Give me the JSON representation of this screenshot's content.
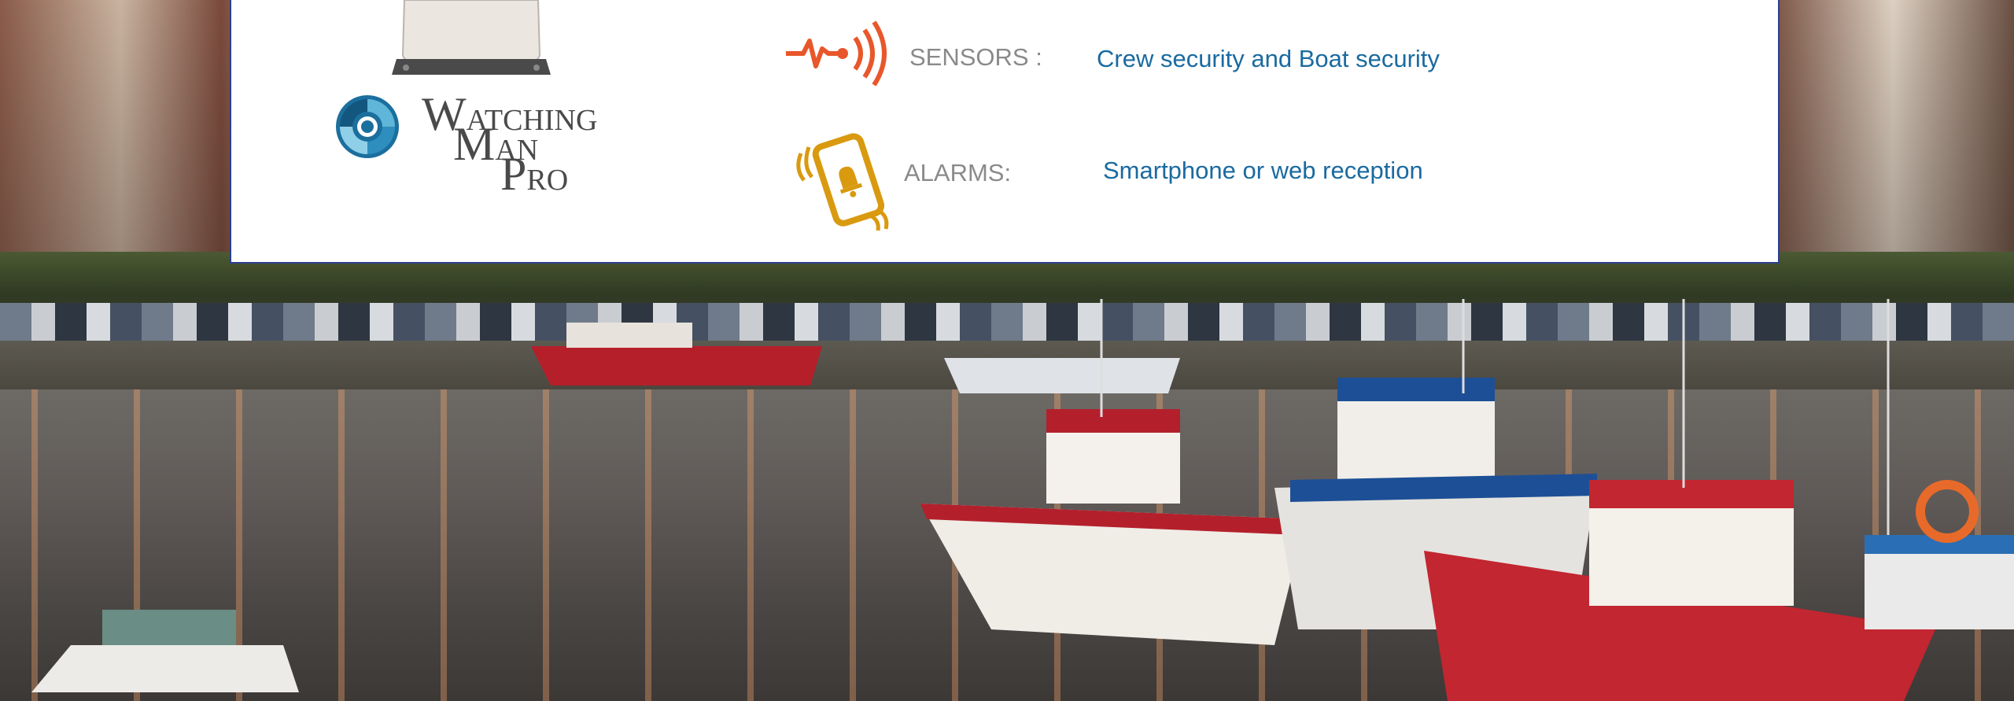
{
  "logo": {
    "line1_initial": "W",
    "line1_rest": "ATCHING",
    "line2_initial": "M",
    "line2_rest": "AN",
    "line3_initial": "P",
    "line3_rest": "RO"
  },
  "features": [
    {
      "icon": "pulse-signal-icon",
      "label": "SENSORS :",
      "value": "Crew security and Boat security"
    },
    {
      "icon": "smartphone-alarm-icon",
      "label": "ALARMS:",
      "value": "Smartphone or web reception"
    }
  ],
  "colors": {
    "panel_border": "#2d3f8f",
    "label_text": "#8a8a8a",
    "value_text": "#1a6aa0",
    "sensor_icon": "#e8572b",
    "alarm_icon": "#d99a10",
    "logo_blue": "#1b6f9e"
  }
}
